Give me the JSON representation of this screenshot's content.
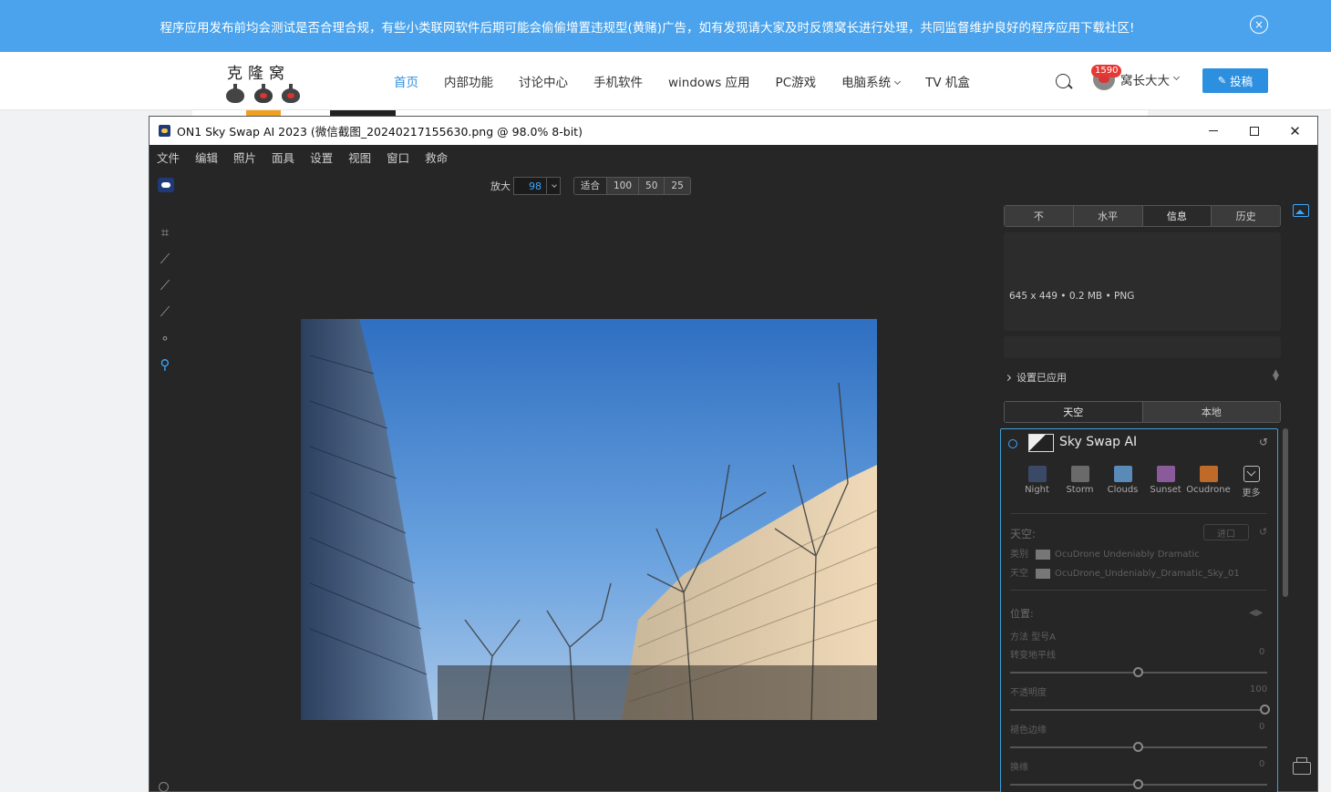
{
  "notice": {
    "text": "程序应用发布前均会测试是否合理合规，有些小类联网软件后期可能会偷偷增置违规型(黄赌)广告，如有发现请大家及时反馈窝长进行处理，共同监督维护良好的程序应用下载社区!",
    "close": "×"
  },
  "site": {
    "logo_text": "克隆窝",
    "nav": [
      {
        "label": "首页",
        "active": true
      },
      {
        "label": "内部功能"
      },
      {
        "label": "讨论中心"
      },
      {
        "label": "手机软件"
      },
      {
        "label": "windows 应用"
      },
      {
        "label": "PC游戏"
      },
      {
        "label": "电脑系统",
        "has_dropdown": true
      },
      {
        "label": "TV 机盒"
      }
    ],
    "badge_count": "1590",
    "username": "窝长大大",
    "submit_label": "投稿"
  },
  "app": {
    "title": "ON1 Sky Swap AI 2023 (微信截图_20240217155630.png @ 98.0% 8-bit)",
    "menu": [
      "文件",
      "编辑",
      "照片",
      "面具",
      "设置",
      "视图",
      "窗口",
      "救命"
    ],
    "zoom_label": "放大",
    "zoom_value": "98",
    "zoom_presets": [
      "适合",
      "100",
      "50",
      "25"
    ],
    "panel_tabs": [
      "不",
      "水平",
      "信息",
      "历史"
    ],
    "active_panel_tab": 2,
    "info_text": "645 x 449 • 0.2 MB • PNG",
    "settings_applied": "设置已应用",
    "mode_tabs": [
      "天空",
      "本地"
    ],
    "sky": {
      "title": "Sky Swap AI",
      "presets": [
        {
          "label": "Night",
          "color": "#3a4a66"
        },
        {
          "label": "Storm",
          "color": "#6a6a6a"
        },
        {
          "label": "Clouds",
          "color": "#5a8ab8"
        },
        {
          "label": "Sunset",
          "color": "#8a5a9a"
        },
        {
          "label": "Ocudrone",
          "color": "#c06a2a"
        },
        {
          "label": "更多",
          "color": ""
        }
      ],
      "sky_section": "天空:",
      "enter_label": "进口",
      "category_label": "类别",
      "category_value": "OcuDrone Undeniably Dramatic",
      "sky_label": "天空",
      "sky_value": "OcuDrone_Undeniably_Dramatic_Sky_01",
      "position_section": "位置:",
      "method_label": "方法",
      "method_value": "型号A",
      "horizon_label": "转变地平线",
      "horizon_value": "0",
      "opacity_label": "不透明度",
      "opacity_value": "100",
      "color_edge_label": "褪色边缘",
      "color_edge_value": "0",
      "shift_label": "换缘",
      "shift_value": "0"
    }
  }
}
